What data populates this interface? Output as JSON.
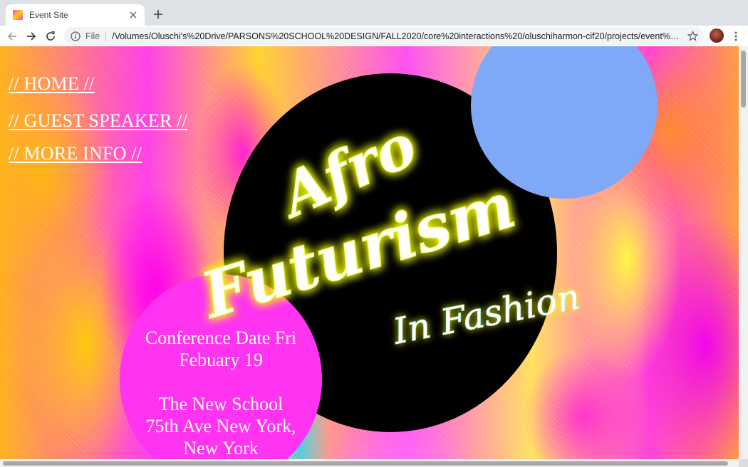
{
  "browser": {
    "tab_title": "Event Site",
    "scheme_label": "File",
    "url": "/Volumes/Oluschi's%20Drive/PARSONS%20SCHOOL%20DESIGN/FALL2020/core%20interactions%20/oluschiharmon-cif20/projects/event%20poster...",
    "icons": {
      "back": "arrow-left-icon",
      "forward": "arrow-right-icon",
      "reload": "reload-icon",
      "info": "info-icon",
      "bookmark": "star-icon",
      "close_tab": "close-icon",
      "new_tab": "plus-icon",
      "menu": "more-vertical-icon"
    }
  },
  "nav": {
    "links": [
      {
        "label": "// HOME //"
      },
      {
        "label": "// GUEST SPEAKER //"
      },
      {
        "label": "// MORE INFO //"
      }
    ]
  },
  "poster": {
    "title_line1": "Afro",
    "title_line2": "Futurism",
    "subtitle": "In Fashion",
    "date_line1": "Conference Date Fri",
    "date_line2": "Febuary 19",
    "venue_line1": "The New School",
    "venue_line2": "75th Ave New York,",
    "venue_line3": "New York"
  },
  "colors": {
    "black_oval": "#000000",
    "blue_circle": "#7fa8f6",
    "pink_circle": "#ff33f0",
    "title_glow": "#f3ff00",
    "text": "#ffffff"
  }
}
